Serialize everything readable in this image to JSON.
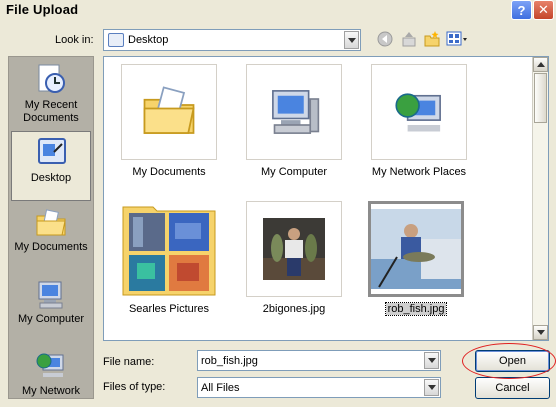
{
  "window": {
    "title": "File Upload"
  },
  "lookin": {
    "label": "Look in:",
    "value": "Desktop"
  },
  "places": [
    {
      "label": "My Recent Documents"
    },
    {
      "label": "Desktop"
    },
    {
      "label": "My Documents"
    },
    {
      "label": "My Computer"
    },
    {
      "label": "My Network"
    }
  ],
  "files": [
    {
      "name": "My Documents",
      "icon": "folder-documents-icon"
    },
    {
      "name": "My Computer",
      "icon": "computer-icon"
    },
    {
      "name": "My Network Places",
      "icon": "network-places-icon"
    },
    {
      "name": "Searles Pictures",
      "icon": "picture-folder-icon"
    },
    {
      "name": "2bigones.jpg",
      "icon": "image-thumbnail-icon"
    },
    {
      "name": "rob_fish.jpg",
      "icon": "image-thumbnail-icon"
    }
  ],
  "filename": {
    "label": "File name:",
    "value": "rob_fish.jpg"
  },
  "filetype": {
    "label": "Files of type:",
    "value": "All Files"
  },
  "buttons": {
    "open": "Open",
    "cancel": "Cancel"
  },
  "colors": {
    "annotation": "#e02020",
    "selection": "#cfcfcf"
  }
}
